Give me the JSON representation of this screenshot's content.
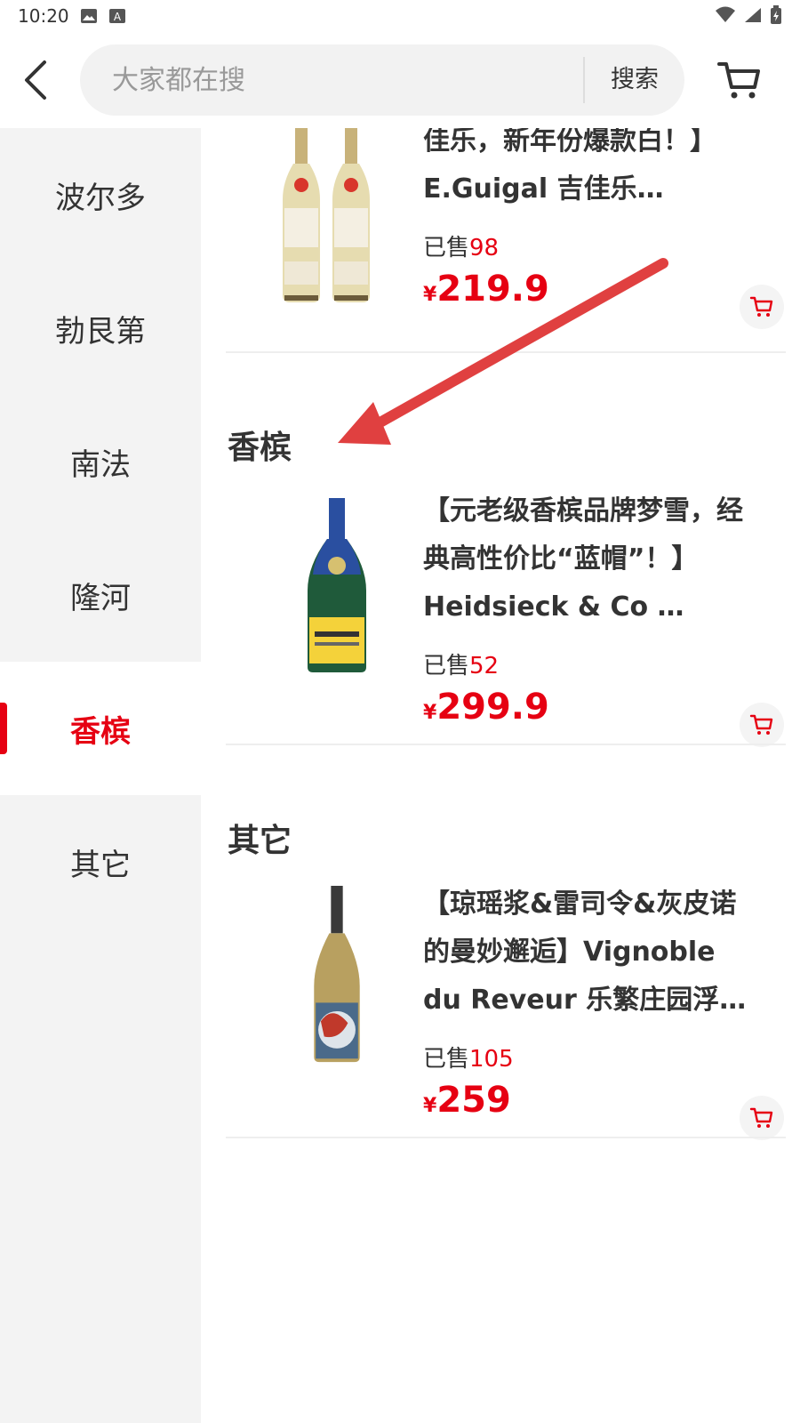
{
  "status_bar": {
    "time": "10:20",
    "left_icons": [
      "image-icon",
      "a-icon"
    ],
    "right_icons": [
      "wifi-icon",
      "signal-icon",
      "battery-charging-icon"
    ]
  },
  "header": {
    "search_placeholder": "大家都在搜",
    "search_button": "搜索",
    "icons": [
      "back-arrow-icon",
      "cart-icon"
    ]
  },
  "sidebar": {
    "items": [
      {
        "label": "波尔多"
      },
      {
        "label": "勃艮第"
      },
      {
        "label": "南法"
      },
      {
        "label": "隆河"
      },
      {
        "label": "香槟",
        "selected": true
      },
      {
        "label": "其它"
      }
    ]
  },
  "main": {
    "sections": [
      {
        "products": [
          {
            "title": "【西方最新进，首席酒庄吉佳乐，新年份爆款白！】E.Guigal 吉佳乐…",
            "sold_label": "已售",
            "sold_count": "98",
            "currency": "¥",
            "price": "219.9"
          }
        ]
      },
      {
        "title": "香槟",
        "products": [
          {
            "title": "【元老级香槟品牌梦雪，经典高性价比“蓝帽”！】Heidsieck & Co …",
            "sold_label": "已售",
            "sold_count": "52",
            "currency": "¥",
            "price": "299.9"
          }
        ]
      },
      {
        "title": "其它",
        "products": [
          {
            "title": "【琼瑶浆&雷司令&灰皮诺的曼妙邂逅】Vignoble du Reveur 乐繁庄园浮尘一…",
            "sold_label": "已售",
            "sold_count": "105",
            "currency": "¥",
            "price": "259"
          }
        ]
      }
    ]
  },
  "colors": {
    "accent_red": "#e60012",
    "sidebar_bg": "#f3f3f3",
    "search_bg": "#f2f2f2",
    "annotation_arrow": "#e04040"
  }
}
